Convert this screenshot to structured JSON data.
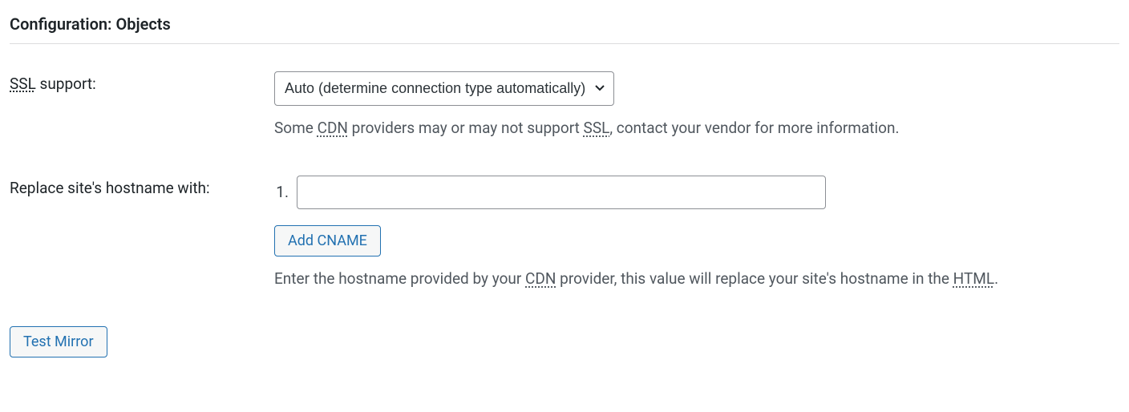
{
  "section": {
    "title": "Configuration: Objects"
  },
  "ssl": {
    "label_prefix": "SSL",
    "label_suffix": " support:",
    "selected": "Auto (determine connection type automatically)",
    "desc_before": "Some ",
    "desc_abbr1": "CDN",
    "desc_mid": " providers may or may not support ",
    "desc_abbr2": "SSL",
    "desc_after": ", contact your vendor for more information."
  },
  "hostname": {
    "label": "Replace site's hostname with:",
    "index": "1.",
    "value": "",
    "add_btn": "Add CNAME",
    "desc_before": "Enter the hostname provided by your ",
    "desc_abbr1": "CDN",
    "desc_mid": " provider, this value will replace your site's hostname in the ",
    "desc_abbr2": "HTML",
    "desc_after": "."
  },
  "buttons": {
    "test_mirror": "Test Mirror"
  }
}
